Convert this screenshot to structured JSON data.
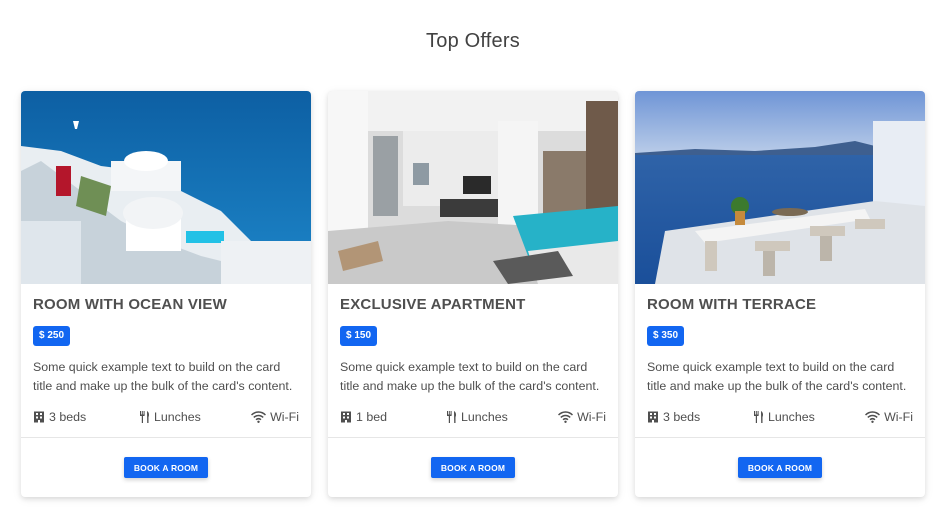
{
  "section": {
    "title": "Top Offers"
  },
  "cards": [
    {
      "title": "ROOM WITH OCEAN VIEW",
      "price": "$ 250",
      "text": "Some quick example text to build on the card title and make up the bulk of the card's content.",
      "amenities": [
        {
          "icon": "building-icon",
          "label": "3 beds"
        },
        {
          "icon": "utensils-icon",
          "label": "Lunches"
        },
        {
          "icon": "wifi-icon",
          "label": "Wi-Fi"
        }
      ],
      "button": "BOOK A ROOM"
    },
    {
      "title": "EXCLUSIVE APARTMENT",
      "price": "$ 150",
      "text": "Some quick example text to build on the card title and make up the bulk of the card's content.",
      "amenities": [
        {
          "icon": "building-icon",
          "label": "1 bed"
        },
        {
          "icon": "utensils-icon",
          "label": "Lunches"
        },
        {
          "icon": "wifi-icon",
          "label": "Wi-Fi"
        }
      ],
      "button": "BOOK A ROOM"
    },
    {
      "title": "ROOM WITH TERRACE",
      "price": "$ 350",
      "text": "Some quick example text to build on the card title and make up the bulk of the card's content.",
      "amenities": [
        {
          "icon": "building-icon",
          "label": "3 beds"
        },
        {
          "icon": "utensils-icon",
          "label": "Lunches"
        },
        {
          "icon": "wifi-icon",
          "label": "Wi-Fi"
        }
      ],
      "button": "BOOK A ROOM"
    }
  ],
  "colors": {
    "primary": "#1266f1",
    "text": "#4f4f4f",
    "title": "#424242"
  }
}
